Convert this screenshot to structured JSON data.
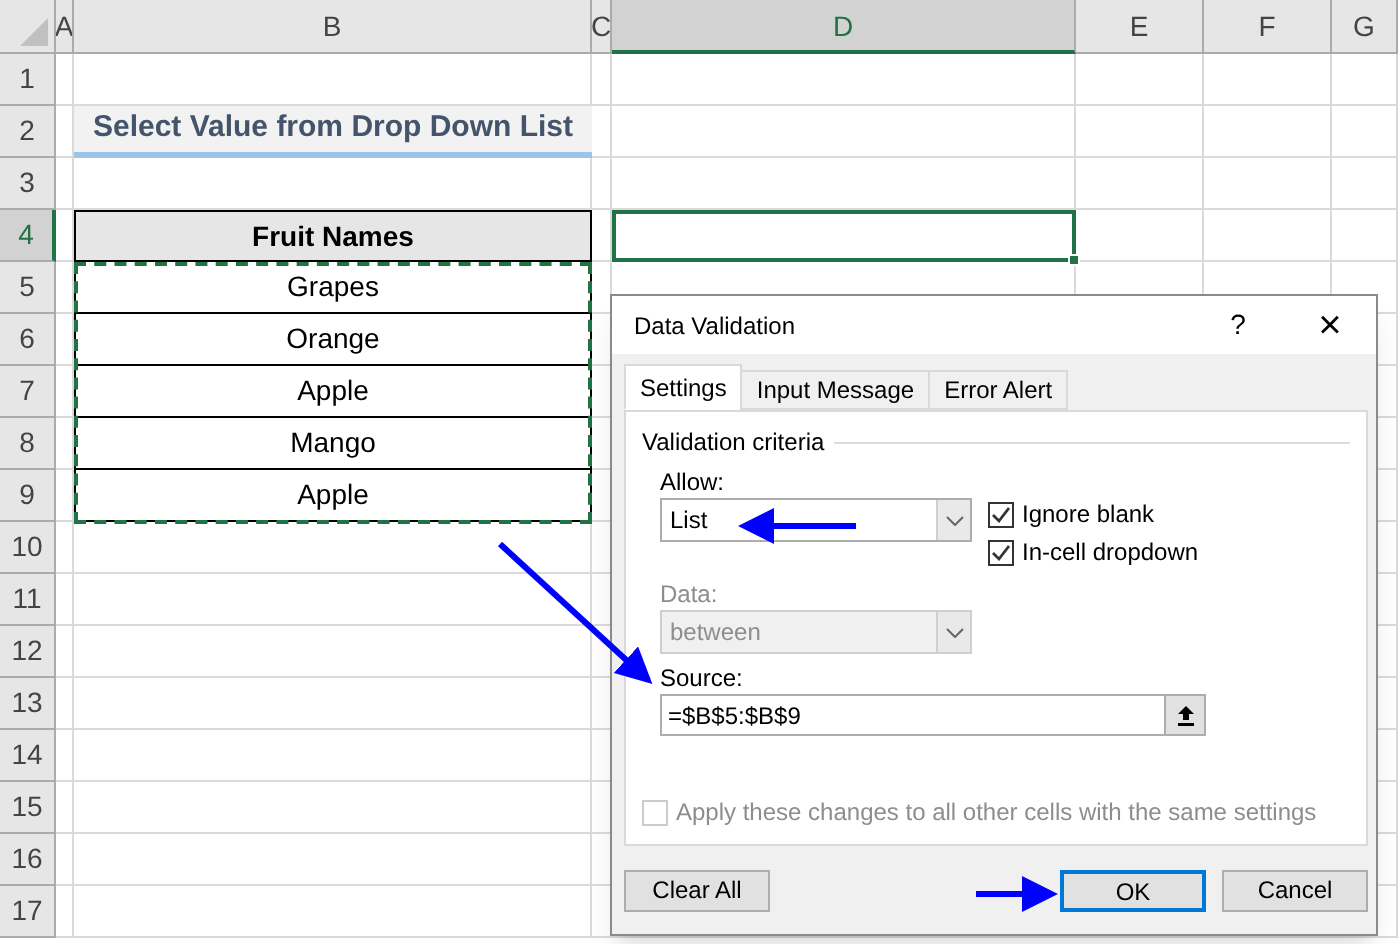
{
  "sheet": {
    "columns": [
      {
        "label": "A",
        "selected": false
      },
      {
        "label": "B",
        "selected": false
      },
      {
        "label": "C",
        "selected": false
      },
      {
        "label": "D",
        "selected": true
      },
      {
        "label": "E",
        "selected": false
      },
      {
        "label": "F",
        "selected": false
      },
      {
        "label": "G",
        "selected": false
      }
    ],
    "rows": [
      {
        "label": "1",
        "selected": false
      },
      {
        "label": "2",
        "selected": false
      },
      {
        "label": "3",
        "selected": false
      },
      {
        "label": "4",
        "selected": true
      },
      {
        "label": "5",
        "selected": false
      },
      {
        "label": "6",
        "selected": false
      },
      {
        "label": "7",
        "selected": false
      },
      {
        "label": "8",
        "selected": false
      },
      {
        "label": "9",
        "selected": false
      },
      {
        "label": "10",
        "selected": false
      },
      {
        "label": "11",
        "selected": false
      },
      {
        "label": "12",
        "selected": false
      },
      {
        "label": "13",
        "selected": false
      },
      {
        "label": "14",
        "selected": false
      },
      {
        "label": "15",
        "selected": false
      },
      {
        "label": "16",
        "selected": false
      },
      {
        "label": "17",
        "selected": false
      }
    ],
    "title": "Select Value from Drop Down List",
    "table": {
      "header": "Fruit Names",
      "items": [
        "Grapes",
        "Orange",
        "Apple",
        "Mango",
        "Apple"
      ],
      "copied": true
    }
  },
  "dialog": {
    "title": "Data Validation",
    "help": "?",
    "close": "×",
    "tabs": [
      {
        "label": "Settings",
        "selected": true
      },
      {
        "label": "Input Message",
        "selected": false
      },
      {
        "label": "Error Alert",
        "selected": false
      }
    ],
    "group": "Validation criteria",
    "allow": {
      "label": "Allow:",
      "value": "List"
    },
    "checkboxes": [
      {
        "label": "Ignore blank",
        "checked": true
      },
      {
        "label": "In-cell dropdown",
        "checked": true
      }
    ],
    "data": {
      "label": "Data:",
      "value": "between",
      "disabled": true
    },
    "source": {
      "label": "Source:",
      "value": "=$B$5:$B$9"
    },
    "apply": {
      "label": "Apply these changes to all other cells with the same settings",
      "checked": false,
      "disabled": true
    },
    "buttons": [
      {
        "label": "Clear All",
        "default": false
      },
      {
        "label": "OK",
        "default": true
      },
      {
        "label": "Cancel",
        "default": false
      }
    ]
  }
}
